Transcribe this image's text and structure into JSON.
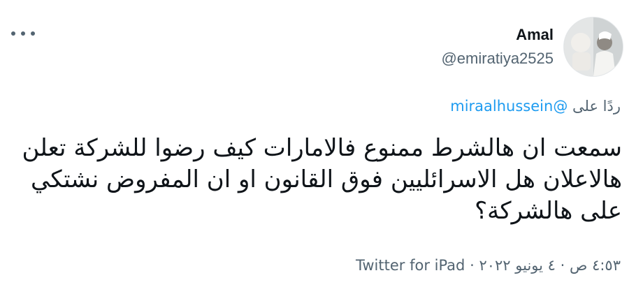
{
  "author": {
    "display_name": "Amal",
    "handle": "@emiratiya2525"
  },
  "reply": {
    "prefix": "ردًا على",
    "mention": "@miraalhussein"
  },
  "tweet": {
    "text": "سمعت ان هالشرط ممنوع فالامارات كيف رضوا للشركة تعلن هالاعلان هل الاسرائليين فوق القانون او ان المفروض نشتكي على هالشركة؟"
  },
  "meta": {
    "time": "٤:٥٣ ص",
    "separator": "·",
    "date": "٤ يونيو ٢٠٢٢",
    "source": "Twitter for iPad"
  },
  "icons": {
    "more": "more-icon"
  }
}
